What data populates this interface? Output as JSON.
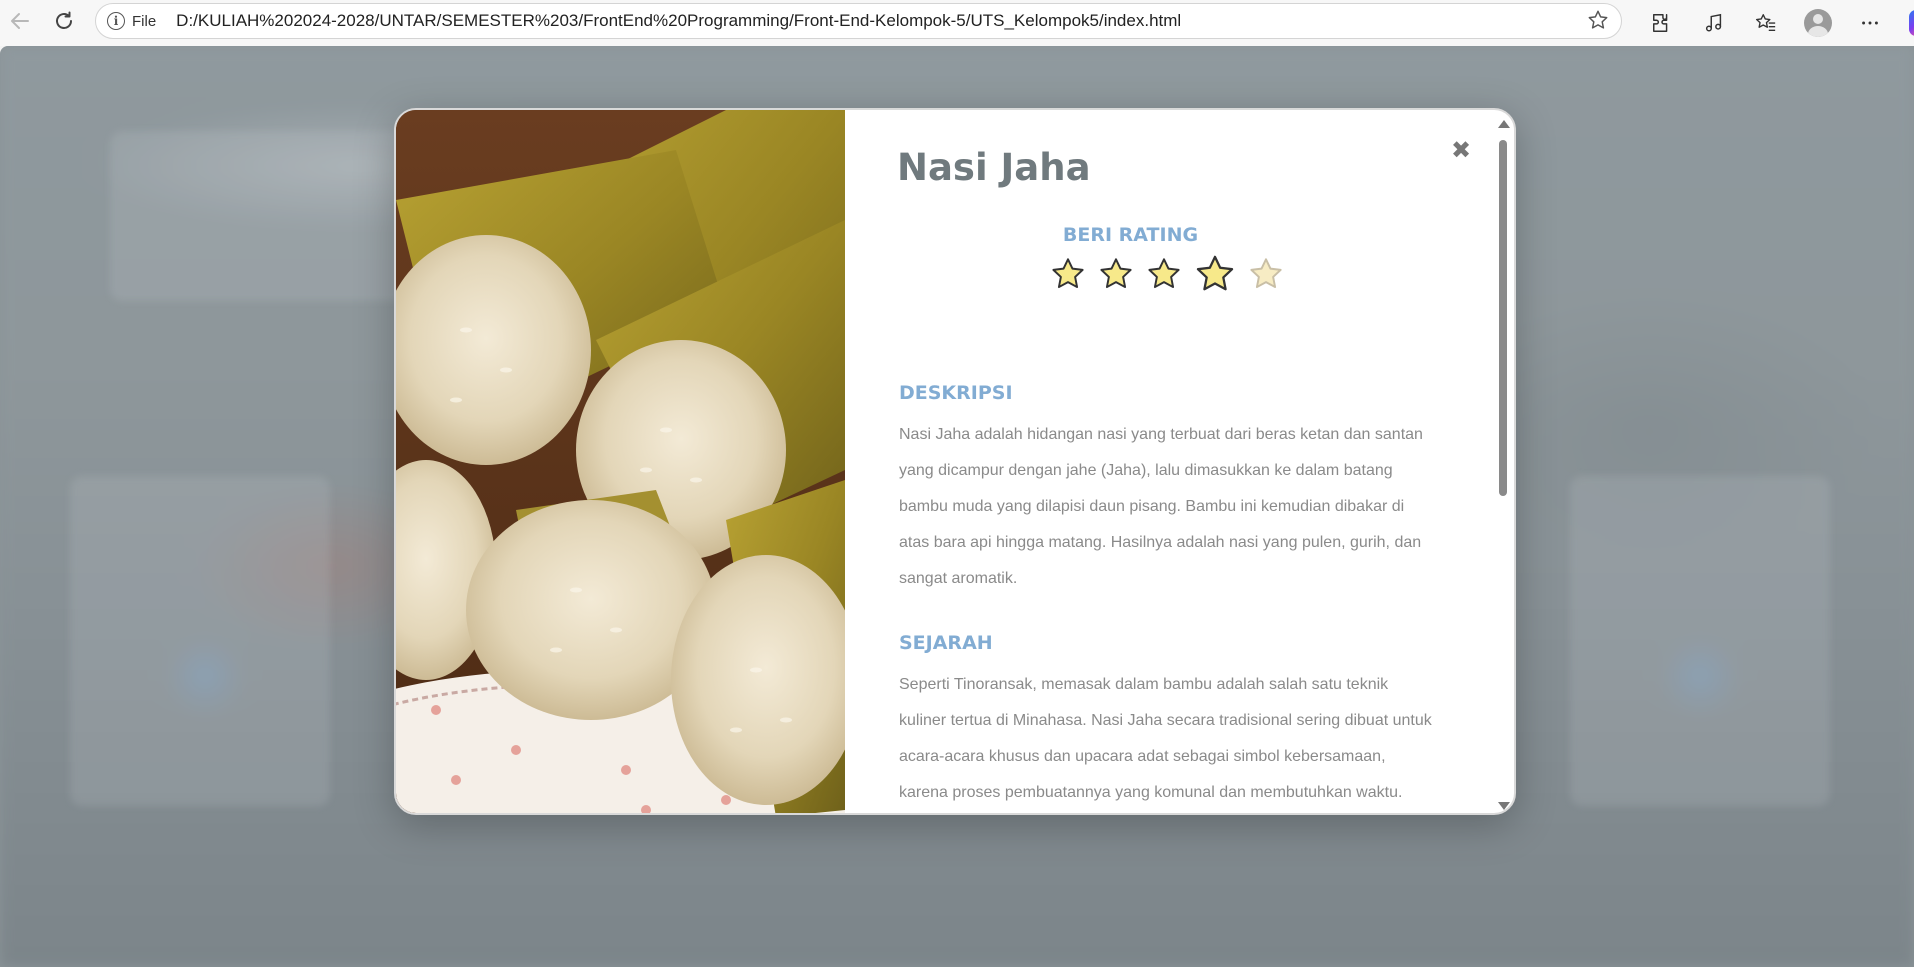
{
  "browser": {
    "file_label": "File",
    "url": "D:/KULIAH%202024-2028/UNTAR/SEMESTER%203/FrontEnd%20Programming/Front-End-Kelompok-5/UTS_Kelompok5/index.html",
    "icons": [
      "back-icon",
      "refresh-icon",
      "info-icon",
      "favorite-star-icon",
      "extensions-icon",
      "read-aloud-icon",
      "favorites-icon",
      "profile-avatar",
      "more-icon",
      "copilot-icon"
    ]
  },
  "modal": {
    "title": "Nasi Jaha",
    "close_icon": "✖",
    "rating_label": "BERI RATING",
    "rating": {
      "selected": 4,
      "max": 5
    },
    "colors": {
      "title": "#707a7e",
      "accent": "#82acd3",
      "text": "#8a8a8a",
      "star_filled": "#f7e98a",
      "star_empty": "#f7ecc4"
    },
    "sections": [
      {
        "heading": "DESKRIPSI",
        "text": "Nasi Jaha adalah hidangan nasi yang terbuat dari beras ketan dan santan yang dicampur dengan jahe (Jaha), lalu dimasukkan ke dalam batang bambu muda yang dilapisi daun pisang. Bambu ini kemudian dibakar di atas bara api hingga matang. Hasilnya adalah nasi yang pulen, gurih, dan sangat aromatik."
      },
      {
        "heading": "SEJARAH",
        "text": "Seperti Tinoransak, memasak dalam bambu adalah salah satu teknik kuliner tertua di Minahasa. Nasi Jaha secara tradisional sering dibuat untuk acara-acara khusus dan upacara adat sebagai simbol kebersamaan, karena proses pembuatannya yang komunal dan membutuhkan waktu."
      }
    ]
  }
}
